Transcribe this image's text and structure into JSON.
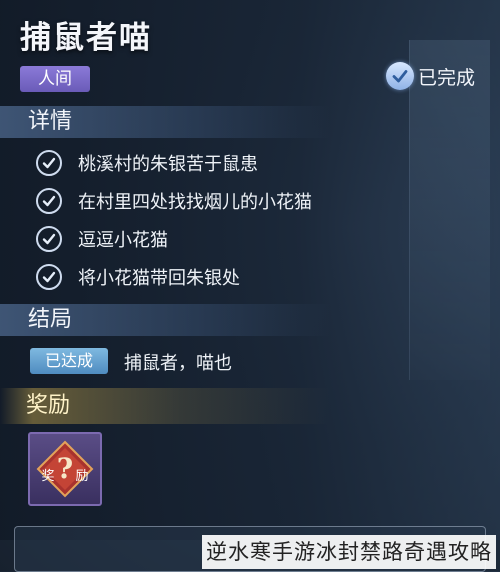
{
  "quest": {
    "title": "捕鼠者喵",
    "realm": "人间",
    "status": "已完成"
  },
  "details": {
    "header": "详情",
    "tasks": [
      {
        "label": "桃溪村的朱银苦于鼠患",
        "done": true
      },
      {
        "label": "在村里四处找找烟儿的小花猫",
        "done": true
      },
      {
        "label": "逗逗小花猫",
        "done": true
      },
      {
        "label": "将小花猫带回朱银处",
        "done": true
      }
    ]
  },
  "ending": {
    "header": "结局",
    "badge": "已达成",
    "text": "捕鼠者，喵也"
  },
  "reward": {
    "header": "奖励",
    "item_icon": "mystery-reward-icon",
    "item_label_left": "奖",
    "item_label_right": "励",
    "item_symbol": "?"
  },
  "watermark": "逆水寒手游冰封禁路奇遇攻略",
  "colors": {
    "realm_badge": "#7a6bc9",
    "achieved_badge": "#6aa6d6",
    "reward_accent": "#c9a84f"
  }
}
